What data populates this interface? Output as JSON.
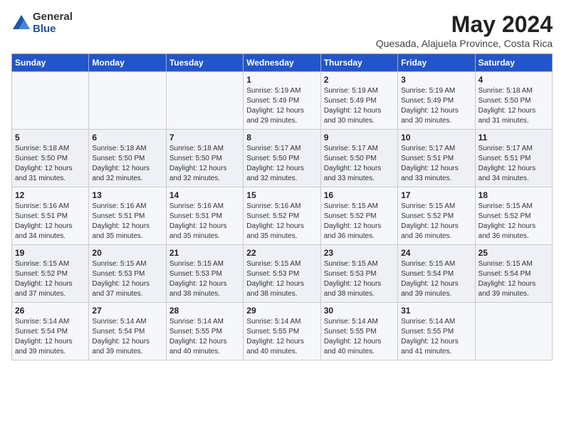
{
  "header": {
    "logo_general": "General",
    "logo_blue": "Blue",
    "title": "May 2024",
    "location": "Quesada, Alajuela Province, Costa Rica"
  },
  "days_of_week": [
    "Sunday",
    "Monday",
    "Tuesday",
    "Wednesday",
    "Thursday",
    "Friday",
    "Saturday"
  ],
  "weeks": [
    [
      {
        "day": "",
        "info": ""
      },
      {
        "day": "",
        "info": ""
      },
      {
        "day": "",
        "info": ""
      },
      {
        "day": "1",
        "info": "Sunrise: 5:19 AM\nSunset: 5:49 PM\nDaylight: 12 hours and 29 minutes."
      },
      {
        "day": "2",
        "info": "Sunrise: 5:19 AM\nSunset: 5:49 PM\nDaylight: 12 hours and 30 minutes."
      },
      {
        "day": "3",
        "info": "Sunrise: 5:19 AM\nSunset: 5:49 PM\nDaylight: 12 hours and 30 minutes."
      },
      {
        "day": "4",
        "info": "Sunrise: 5:18 AM\nSunset: 5:50 PM\nDaylight: 12 hours and 31 minutes."
      }
    ],
    [
      {
        "day": "5",
        "info": "Sunrise: 5:18 AM\nSunset: 5:50 PM\nDaylight: 12 hours and 31 minutes."
      },
      {
        "day": "6",
        "info": "Sunrise: 5:18 AM\nSunset: 5:50 PM\nDaylight: 12 hours and 32 minutes."
      },
      {
        "day": "7",
        "info": "Sunrise: 5:18 AM\nSunset: 5:50 PM\nDaylight: 12 hours and 32 minutes."
      },
      {
        "day": "8",
        "info": "Sunrise: 5:17 AM\nSunset: 5:50 PM\nDaylight: 12 hours and 32 minutes."
      },
      {
        "day": "9",
        "info": "Sunrise: 5:17 AM\nSunset: 5:50 PM\nDaylight: 12 hours and 33 minutes."
      },
      {
        "day": "10",
        "info": "Sunrise: 5:17 AM\nSunset: 5:51 PM\nDaylight: 12 hours and 33 minutes."
      },
      {
        "day": "11",
        "info": "Sunrise: 5:17 AM\nSunset: 5:51 PM\nDaylight: 12 hours and 34 minutes."
      }
    ],
    [
      {
        "day": "12",
        "info": "Sunrise: 5:16 AM\nSunset: 5:51 PM\nDaylight: 12 hours and 34 minutes."
      },
      {
        "day": "13",
        "info": "Sunrise: 5:16 AM\nSunset: 5:51 PM\nDaylight: 12 hours and 35 minutes."
      },
      {
        "day": "14",
        "info": "Sunrise: 5:16 AM\nSunset: 5:51 PM\nDaylight: 12 hours and 35 minutes."
      },
      {
        "day": "15",
        "info": "Sunrise: 5:16 AM\nSunset: 5:52 PM\nDaylight: 12 hours and 35 minutes."
      },
      {
        "day": "16",
        "info": "Sunrise: 5:15 AM\nSunset: 5:52 PM\nDaylight: 12 hours and 36 minutes."
      },
      {
        "day": "17",
        "info": "Sunrise: 5:15 AM\nSunset: 5:52 PM\nDaylight: 12 hours and 36 minutes."
      },
      {
        "day": "18",
        "info": "Sunrise: 5:15 AM\nSunset: 5:52 PM\nDaylight: 12 hours and 36 minutes."
      }
    ],
    [
      {
        "day": "19",
        "info": "Sunrise: 5:15 AM\nSunset: 5:52 PM\nDaylight: 12 hours and 37 minutes."
      },
      {
        "day": "20",
        "info": "Sunrise: 5:15 AM\nSunset: 5:53 PM\nDaylight: 12 hours and 37 minutes."
      },
      {
        "day": "21",
        "info": "Sunrise: 5:15 AM\nSunset: 5:53 PM\nDaylight: 12 hours and 38 minutes."
      },
      {
        "day": "22",
        "info": "Sunrise: 5:15 AM\nSunset: 5:53 PM\nDaylight: 12 hours and 38 minutes."
      },
      {
        "day": "23",
        "info": "Sunrise: 5:15 AM\nSunset: 5:53 PM\nDaylight: 12 hours and 38 minutes."
      },
      {
        "day": "24",
        "info": "Sunrise: 5:15 AM\nSunset: 5:54 PM\nDaylight: 12 hours and 39 minutes."
      },
      {
        "day": "25",
        "info": "Sunrise: 5:15 AM\nSunset: 5:54 PM\nDaylight: 12 hours and 39 minutes."
      }
    ],
    [
      {
        "day": "26",
        "info": "Sunrise: 5:14 AM\nSunset: 5:54 PM\nDaylight: 12 hours and 39 minutes."
      },
      {
        "day": "27",
        "info": "Sunrise: 5:14 AM\nSunset: 5:54 PM\nDaylight: 12 hours and 39 minutes."
      },
      {
        "day": "28",
        "info": "Sunrise: 5:14 AM\nSunset: 5:55 PM\nDaylight: 12 hours and 40 minutes."
      },
      {
        "day": "29",
        "info": "Sunrise: 5:14 AM\nSunset: 5:55 PM\nDaylight: 12 hours and 40 minutes."
      },
      {
        "day": "30",
        "info": "Sunrise: 5:14 AM\nSunset: 5:55 PM\nDaylight: 12 hours and 40 minutes."
      },
      {
        "day": "31",
        "info": "Sunrise: 5:14 AM\nSunset: 5:55 PM\nDaylight: 12 hours and 41 minutes."
      },
      {
        "day": "",
        "info": ""
      }
    ]
  ]
}
